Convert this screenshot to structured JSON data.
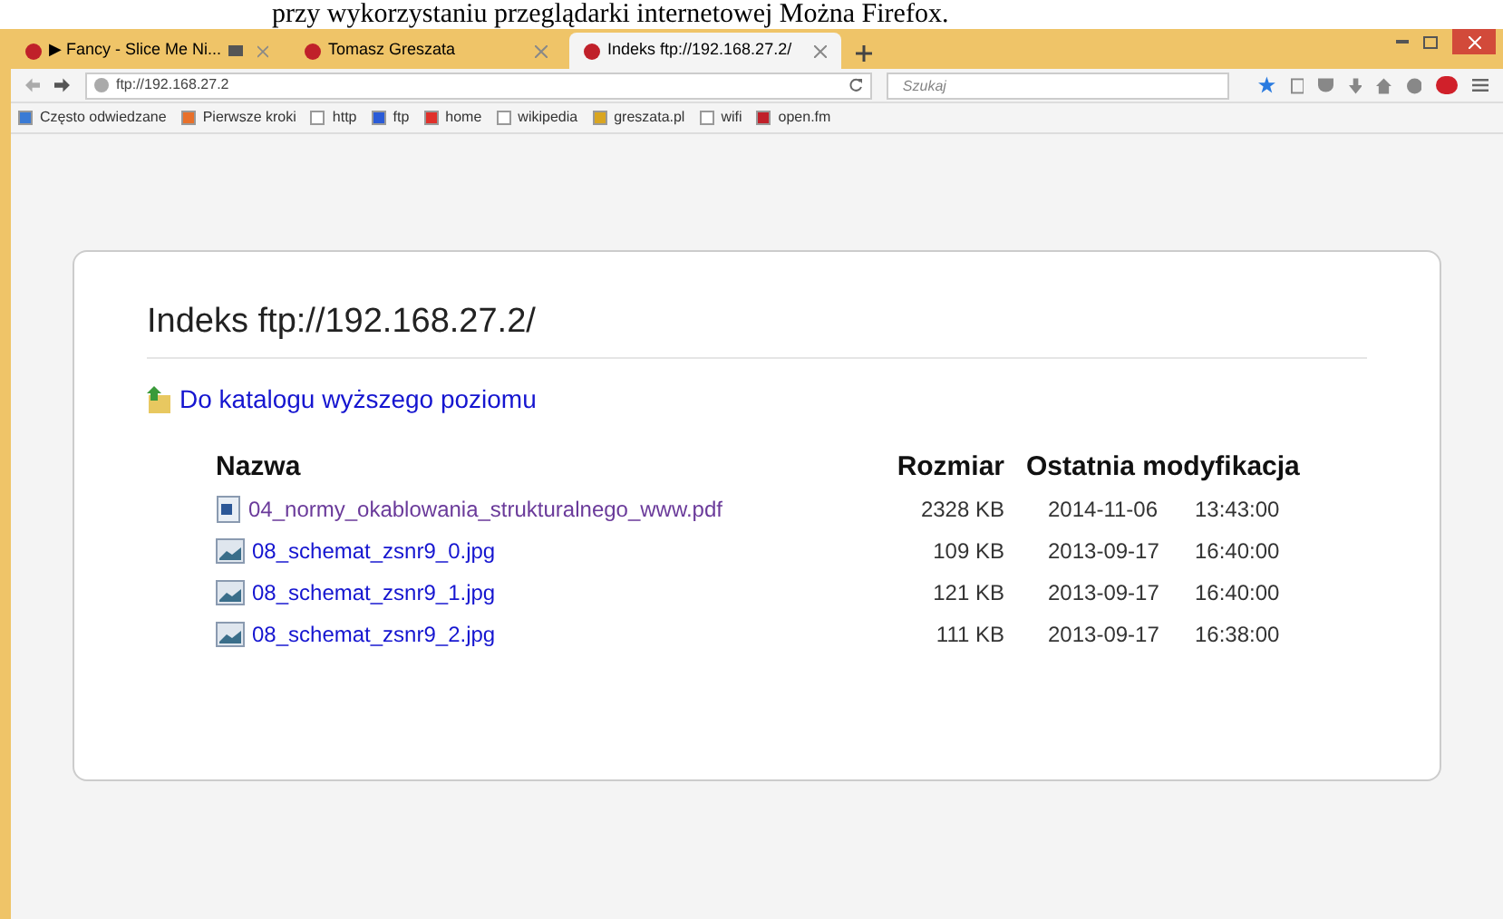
{
  "document_text": "przy wykorzystaniu przeglądarki internetowej Można Firefox.",
  "tabs": [
    {
      "title": "▶ Fancy - Slice Me Ni...",
      "audio": true,
      "selected": false
    },
    {
      "title": "Tomasz Greszata",
      "audio": false,
      "selected": false
    },
    {
      "title": "Indeks ftp://192.168.27.2/",
      "audio": false,
      "selected": true
    }
  ],
  "address": "ftp://192.168.27.2",
  "search": {
    "placeholder": "Szukaj"
  },
  "bookmarks": [
    "Często odwiedzane",
    "Pierwsze kroki",
    "http",
    "ftp",
    "home",
    "wikipedia",
    "greszata.pl",
    "wifi",
    "open.fm"
  ],
  "page": {
    "title": "Indeks ftp://192.168.27.2/",
    "up_link": "Do katalogu wyższego poziomu",
    "columns": [
      "Nazwa",
      "Rozmiar",
      "Ostatnia modyfikacja"
    ],
    "rows": [
      {
        "kind": "document",
        "name": "04_normy_okablowania_strukturalnego_www.pdf",
        "visited": true,
        "size": "2328 KB",
        "date": "2014-11-06",
        "time": "13:43:00"
      },
      {
        "kind": "image",
        "name": "08_schemat_zsnr9_0.jpg",
        "visited": false,
        "size": "109 KB",
        "date": "2013-09-17",
        "time": "16:40:00"
      },
      {
        "kind": "image",
        "name": "08_schemat_zsnr9_1.jpg",
        "visited": false,
        "size": "121 KB",
        "date": "2013-09-17",
        "time": "16:40:00"
      },
      {
        "kind": "image",
        "name": "08_schemat_zsnr9_2.jpg",
        "visited": false,
        "size": "111 KB",
        "date": "2013-09-17",
        "time": "16:38:00"
      }
    ]
  }
}
